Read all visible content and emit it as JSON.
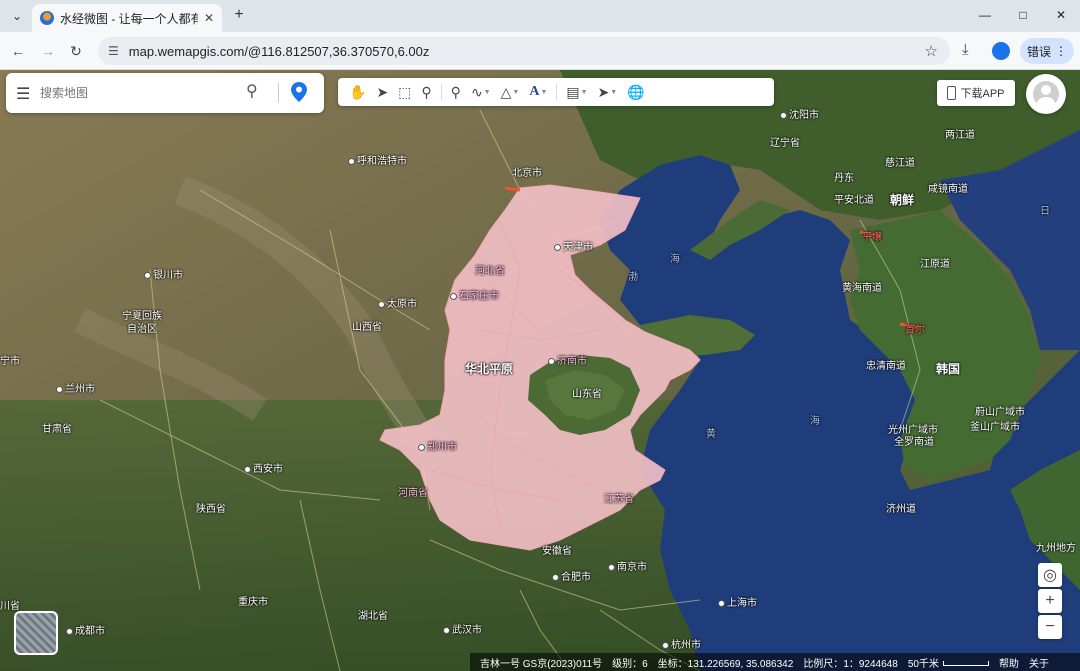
{
  "browser": {
    "tab_title": "水经微图 - 让每一个人都有自己",
    "url": "map.wemapgis.com/@116.812507,36.370570,6.00z",
    "error_label": "错误"
  },
  "search": {
    "placeholder": "搜索地图"
  },
  "toolbar": {
    "icons": [
      "hand-icon",
      "select-arrow-icon",
      "box-select-icon",
      "zoom-fit-icon",
      "marker-icon",
      "polyline-icon",
      "polygon-icon",
      "text-icon",
      "measure-ruler-icon",
      "query-pointer-icon",
      "globe-icon"
    ]
  },
  "download_app": "下载APP",
  "map": {
    "region_labels": {
      "north_china_plain": "华北平原",
      "shandong": "山东省"
    },
    "places": {
      "shenyang": "沈阳市",
      "liaoning": "辽宁省",
      "huhehaote": "呼和浩特市",
      "beijing": "北京市",
      "tianjin": "天津市",
      "hebei": "河北省",
      "shijiazhuang": "石家庄市",
      "taiyuan": "太原市",
      "shanxi": "山西省",
      "jinan": "济南市",
      "yinchuan": "银川市",
      "ningxia": "宁夏回族自治区",
      "lanzhou": "兰州市",
      "gansu": "甘肃省",
      "xian": "西安市",
      "shaanxi": "陕西省",
      "zhengzhou": "郑州市",
      "henan": "河南省",
      "jiangsu": "江苏省",
      "anhui": "安徽省",
      "hefei": "合肥市",
      "nanjing": "南京市",
      "shanghai": "上海市",
      "hangzhou": "杭州市",
      "wuhan": "武汉市",
      "hubei": "湖北省",
      "chongqing": "重庆市",
      "chengdu": "成都市",
      "xining": "宁市",
      "sichuan": "川省",
      "dandong": "丹东",
      "pingan_beidao": "平安北道",
      "chaoxian": "朝鲜",
      "cijiang": "慈江道",
      "liangjiang": "两江道",
      "xianjing_nandao": "咸镜南道",
      "pyongyang": "平壤",
      "huanghai_nandao": "黄海南道",
      "jiangyuan": "江原道",
      "seoul": "首尔",
      "zhongqing_nandao": "忠清南道",
      "hanguo": "韩国",
      "guangzhou_kr": "光州广域市",
      "quanluo_nandao": "全罗南道",
      "daqiu": "蔚山广域市",
      "fushan": "釜山广域市",
      "jizhou": "济州道",
      "jiuzhou": "九州地方",
      "bohai": "渤",
      "huanghai_sea": "海",
      "huanghai_sea2": "黄",
      "huanghai_sea3": "海",
      "rihai": "日",
      "bohai2": "海"
    }
  },
  "status": {
    "copyright": "吉林一号 GS京(2023)011号",
    "level_label": "级别：",
    "level": "6",
    "coord_label": "坐标：",
    "coord": "131.226569, 35.086342",
    "scale_label": "比例尺：",
    "scale": "1：9244648",
    "scale_distance": "50千米",
    "help": "帮助",
    "about": "关于"
  }
}
